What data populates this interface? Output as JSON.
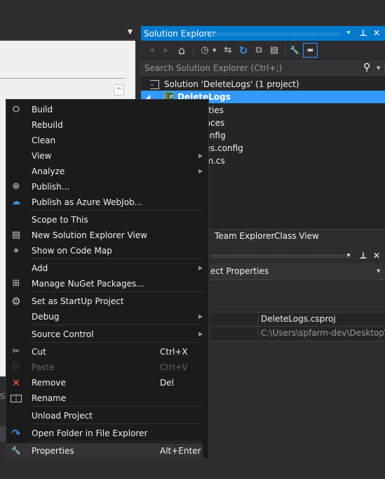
{
  "colors": {
    "accent": "#007acc",
    "selection": "#3399ff",
    "menu_bg": "#1b1b1c",
    "panel_bg": "#252526",
    "chrome_bg": "#2d2d30"
  },
  "editor": {
    "dropdown_icon": "chevron-down-icon",
    "scroll_up_icon": "chevron-up-icon",
    "scroll_up_glyph": "^",
    "left_tab_fragment": "Se"
  },
  "solution_explorer": {
    "title": "Solution Explorer",
    "title_buttons": [
      {
        "icon": "dropdown-icon",
        "glyph": "▾"
      },
      {
        "icon": "pin-icon",
        "glyph": "⊥"
      },
      {
        "icon": "close-icon",
        "glyph": "✕"
      }
    ],
    "toolbar": [
      {
        "icon": "back-icon",
        "glyph": "◀"
      },
      {
        "icon": "forward-icon",
        "glyph": "▶"
      },
      {
        "icon": "home-icon",
        "glyph": "⌂"
      },
      {
        "icon": "pending-changes-filter-icon",
        "glyph": "◷"
      },
      {
        "icon": "sync-icon",
        "glyph": "⇆"
      },
      {
        "icon": "refresh-icon",
        "glyph": "↻"
      },
      {
        "icon": "collapse-all-icon",
        "glyph": "⧉"
      },
      {
        "icon": "show-all-files-icon",
        "glyph": "▤"
      },
      {
        "icon": "properties-icon",
        "glyph": "🔧"
      },
      {
        "icon": "preview-icon",
        "glyph": "▬"
      }
    ],
    "search_placeholder": "Search Solution Explorer (Ctrl+;)",
    "search_icon_glyph": "⚲",
    "tree": [
      {
        "label": "Solution 'DeleteLogs' (1 project)",
        "icon": "solution-icon"
      },
      {
        "label": "DeleteLogs",
        "icon": "csharp-project-icon",
        "selected": true,
        "expanded": true
      },
      {
        "label": "erties",
        "icon": "properties-folder-icon"
      },
      {
        "label": "ences",
        "icon": "references-icon"
      },
      {
        "label": "config",
        "icon": "config-file-icon"
      },
      {
        "label": "ges.config",
        "icon": "config-file-icon"
      },
      {
        "label": "am.cs",
        "icon": "csharp-file-icon"
      }
    ],
    "tabs": [
      "Team Explorer",
      "Class View"
    ]
  },
  "properties_panel": {
    "title_buttons": [
      {
        "icon": "dropdown-icon",
        "glyph": "▾"
      },
      {
        "icon": "pin-icon",
        "glyph": "⊥"
      },
      {
        "icon": "close-icon",
        "glyph": "✕"
      }
    ],
    "object_selector": "ect Properties",
    "rows": [
      {
        "value": "DeleteLogs.csproj"
      },
      {
        "value": "C:\\Users\\spfarm-dev\\Desktop\\De"
      }
    ]
  },
  "context_menu": {
    "items": [
      {
        "label": "Build",
        "icon": "build-icon",
        "glyph": "⛭"
      },
      {
        "label": "Rebuild"
      },
      {
        "label": "Clean"
      },
      {
        "label": "View",
        "submenu": true
      },
      {
        "label": "Analyze",
        "submenu": true
      },
      {
        "label": "Publish...",
        "icon": "publish-icon",
        "glyph": "⊕"
      },
      {
        "label": "Publish as Azure WebJob...",
        "icon": "azure-cloud-icon",
        "glyph": "☁"
      },
      {
        "separator": true
      },
      {
        "label": "Scope to This"
      },
      {
        "label": "New Solution Explorer View",
        "icon": "new-view-icon",
        "glyph": "▤"
      },
      {
        "label": "Show on Code Map",
        "icon": "code-map-icon",
        "glyph": "⚹"
      },
      {
        "separator": true
      },
      {
        "label": "Add",
        "submenu": true
      },
      {
        "label": "Manage NuGet Packages...",
        "icon": "nuget-package-icon",
        "glyph": "⊞"
      },
      {
        "separator": true
      },
      {
        "label": "Set as StartUp Project",
        "icon": "gear-icon",
        "glyph": "⚙"
      },
      {
        "label": "Debug",
        "submenu": true
      },
      {
        "separator": true
      },
      {
        "label": "Source Control",
        "submenu": true
      },
      {
        "separator": true
      },
      {
        "label": "Cut",
        "shortcut": "Ctrl+X",
        "icon": "scissors-icon",
        "glyph": "✂"
      },
      {
        "label": "Paste",
        "shortcut": "Ctrl+V",
        "icon": "paste-icon",
        "glyph": "⎘",
        "disabled": true
      },
      {
        "label": "Remove",
        "shortcut": "Del",
        "icon": "remove-icon",
        "glyph": "✕"
      },
      {
        "label": "Rename",
        "icon": "rename-icon",
        "glyph": "⌶"
      },
      {
        "separator": true
      },
      {
        "label": "Unload Project"
      },
      {
        "separator": true
      },
      {
        "label": "Open Folder in File Explorer",
        "icon": "open-folder-icon",
        "glyph": "↷"
      },
      {
        "separator": true
      },
      {
        "label": "Properties",
        "shortcut": "Alt+Enter",
        "icon": "wrench-icon",
        "glyph": "🔧",
        "hovered": true
      }
    ]
  }
}
